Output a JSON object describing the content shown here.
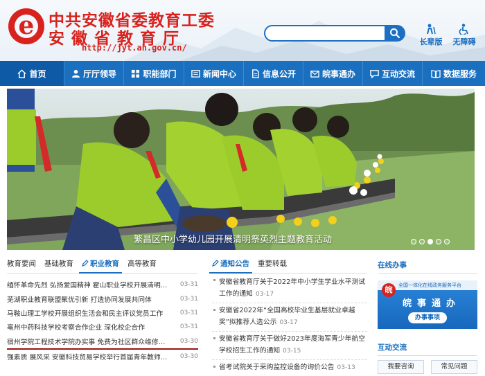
{
  "header": {
    "title_party": "中共安徽省委教育工委",
    "title_dept": "安徽省教育厅",
    "url": "http://jyt.ah.gov.cn/",
    "search_placeholder": "",
    "elder_label": "长辈版",
    "access_label": "无障碍",
    "brand_color": "#d8221d"
  },
  "nav": {
    "items": [
      {
        "label": "首页",
        "icon": "home-icon"
      },
      {
        "label": "厅厅领导",
        "icon": "person-icon"
      },
      {
        "label": "职能部门",
        "icon": "grid-icon"
      },
      {
        "label": "新闻中心",
        "icon": "news-icon"
      },
      {
        "label": "信息公开",
        "icon": "doc-icon"
      },
      {
        "label": "皖事通办",
        "icon": "mail-icon"
      },
      {
        "label": "互动交流",
        "icon": "chat-icon"
      },
      {
        "label": "数据服务",
        "icon": "book-icon"
      }
    ]
  },
  "banner": {
    "caption": "繁昌区中小学幼儿园开展清明祭英烈主题教育活动",
    "slide_count": 5,
    "active_slide": 3
  },
  "news": {
    "tabs": [
      "教育要闻",
      "基础教育",
      "职业教育",
      "高等教育"
    ],
    "active_tab": 2,
    "items": [
      {
        "title": "缅怀革命先烈 弘扬爱国精神 霍山职业学校开展清明...",
        "date": "03-31"
      },
      {
        "title": "芜湖职业教育联盟聚优引新 打造协同发展共同体",
        "date": "03-31"
      },
      {
        "title": "马鞍山理工学校开展组织生活会和民主评议党员工作",
        "date": "03-31"
      },
      {
        "title": "亳州中药科技学校考察合作企业 深化校企合作",
        "date": "03-31"
      },
      {
        "title": "宿州学院工程技术学院办实事 免费为社区群众维修家...",
        "date": "03-30"
      },
      {
        "title": "强素质 展风采 安徽科技贸易学校举行首届青年教师...",
        "date": "03-30"
      }
    ]
  },
  "notices": {
    "tabs": [
      "通知公告",
      "重要转载"
    ],
    "active_tab": 0,
    "items": [
      {
        "title": "安徽省教育厅关于2022年中小学生学业水平测试工作的通知",
        "date": "03-17"
      },
      {
        "title": "安徽省2022年“全国高校毕业生基层就业卓越奖”拟推荐人选公示",
        "date": "03-17"
      },
      {
        "title": "安徽省教育厅关于做好2023年度海军青少年航空学校招生工作的通知",
        "date": "03-15"
      },
      {
        "title": "省考试院关于采购监控设备的询价公告",
        "date": "03-13"
      }
    ]
  },
  "side": {
    "online_title": "在线办事",
    "card_top": "全国一体化在线政务服务平台",
    "card_badge": "皖",
    "card_big": "皖事通办",
    "card_btn": "办事事项",
    "interact_title": "互动交流",
    "quick": [
      "我要咨询",
      "常见问题"
    ]
  },
  "colors": {
    "nav_bg": "#1a6fbf",
    "nav_active": "#0f5aa6",
    "accent": "#1a6fbf"
  }
}
